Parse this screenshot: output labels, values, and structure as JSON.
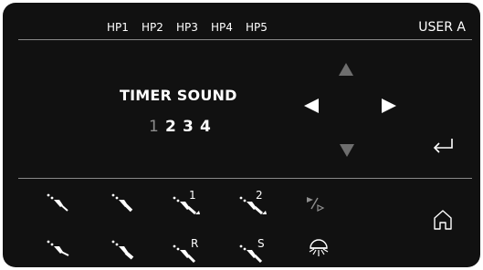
{
  "header": {
    "handpieces": [
      "HP1",
      "HP2",
      "HP3",
      "HP4",
      "HP5"
    ],
    "user_label": "USER A"
  },
  "main": {
    "title": "TIMER SOUND",
    "options": [
      "1",
      "2",
      "3",
      "4"
    ],
    "selected_option": "1"
  },
  "controls": {
    "up": "arrow-up-icon",
    "left": "arrow-left-icon",
    "right": "arrow-right-icon",
    "down": "arrow-down-icon",
    "enter": "enter-icon"
  },
  "toolbar": {
    "row1": [
      {
        "icon": "handpiece-water-icon"
      },
      {
        "icon": "handpiece-air-icon"
      },
      {
        "icon": "handpiece-program-1-icon",
        "label": "1"
      },
      {
        "icon": "handpiece-program-2-icon",
        "label": "2"
      },
      {
        "icon": "play-forward-icon"
      }
    ],
    "row2": [
      {
        "icon": "handpiece-spray-icon"
      },
      {
        "icon": "handpiece-dry-icon"
      },
      {
        "icon": "handpiece-reverse-icon",
        "label": "R"
      },
      {
        "icon": "handpiece-setting-icon",
        "label": "S"
      },
      {
        "icon": "light-icon"
      }
    ],
    "home": "home-icon"
  },
  "colors": {
    "panel": "#111111",
    "text": "#ffffff",
    "dim": "#8e8e8e",
    "disabled_arrow": "#6e6e6e",
    "divider": "#8a8a8a"
  }
}
